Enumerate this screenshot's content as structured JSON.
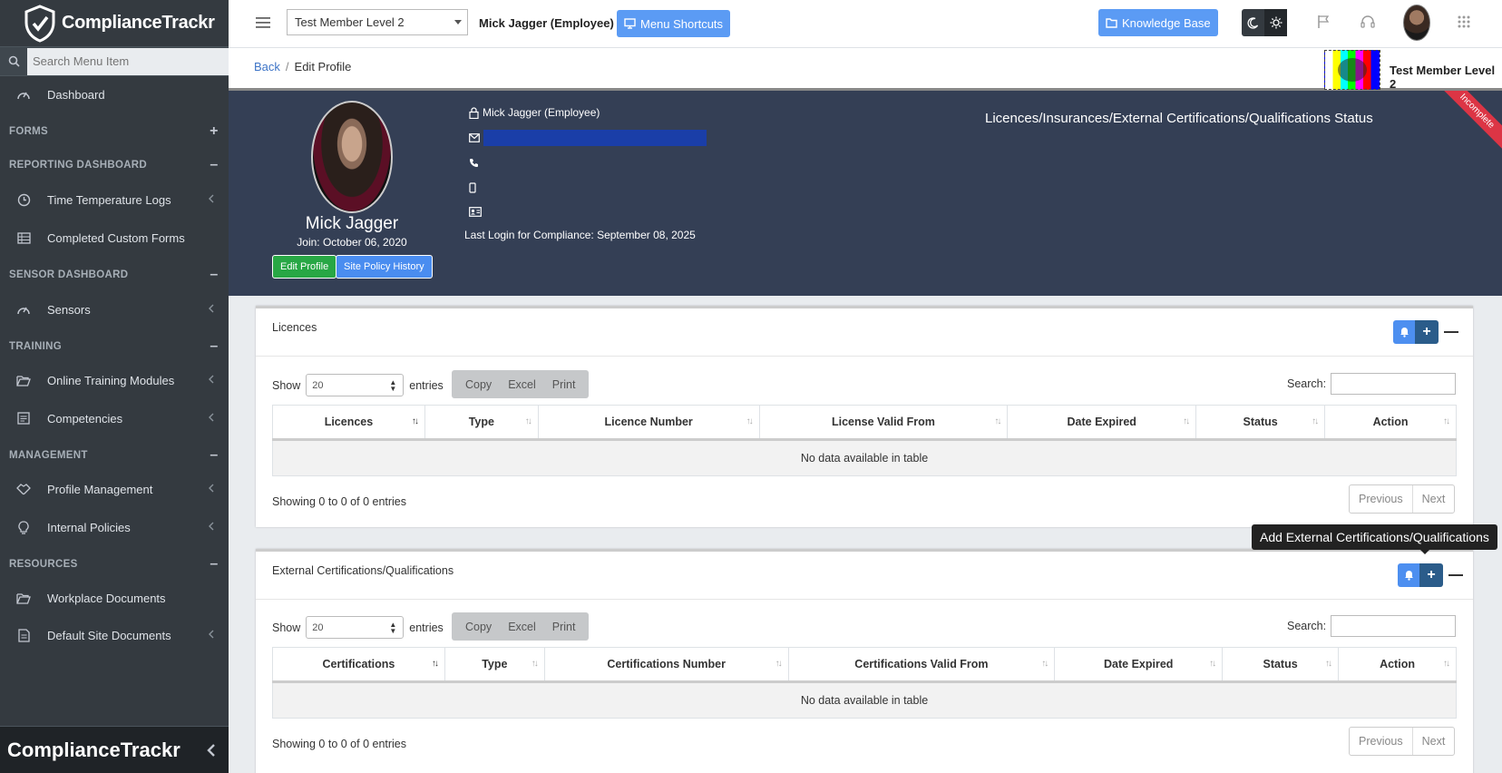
{
  "sidebar": {
    "brand": "ComplianceTrackr",
    "search_placeholder": "Search Menu Item",
    "items": [
      {
        "label": "Dashboard"
      },
      {
        "label": "Time Temperature Logs"
      },
      {
        "label": "Completed Custom Forms"
      },
      {
        "label": "Sensors"
      },
      {
        "label": "Online Training Modules"
      },
      {
        "label": "Competencies"
      },
      {
        "label": "Profile Management"
      },
      {
        "label": "Internal Policies"
      },
      {
        "label": "Workplace Documents"
      },
      {
        "label": "Default Site Documents"
      }
    ],
    "headers": [
      {
        "label": "FORMS",
        "toggle": "+"
      },
      {
        "label": "REPORTING DASHBOARD",
        "toggle": "–"
      },
      {
        "label": "SENSOR DASHBOARD",
        "toggle": "–"
      },
      {
        "label": "TRAINING",
        "toggle": "–"
      },
      {
        "label": "MANAGEMENT",
        "toggle": "–"
      },
      {
        "label": "RESOURCES",
        "toggle": "–"
      }
    ],
    "footer_brand": "ComplianceTrackr"
  },
  "topbar": {
    "member_select": "Test Member Level 2",
    "user_name": "Mick Jagger (Employee)",
    "menu_shortcuts": "Menu Shortcuts",
    "knowledge_base": "Knowledge Base"
  },
  "breadcrumb": {
    "back": "Back",
    "sep": "/",
    "current": "Edit Profile",
    "member_name": "Test Member Level 2"
  },
  "profile": {
    "name": "Mick Jagger",
    "join": "Join: October 06, 2020",
    "edit_btn": "Edit Profile",
    "policy_btn": "Site Policy History",
    "role": "Mick Jagger (Employee)",
    "last_login": "Last Login for Compliance: September 08, 2025",
    "status_title": "Licences/Insurances/External Certifications/Qualifications Status",
    "ribbon": "Incomplete"
  },
  "licences": {
    "title": "Licences",
    "show": "Show",
    "entries_value": "20",
    "entries": "entries",
    "exports": [
      "Copy",
      "Excel",
      "Print"
    ],
    "search_label": "Search:",
    "columns": [
      "Licences",
      "Type",
      "Licence Number",
      "License Valid From",
      "Date Expired",
      "Status",
      "Action"
    ],
    "empty": "No data available in table",
    "showing": "Showing 0 to 0 of 0 entries",
    "prev": "Previous",
    "next": "Next"
  },
  "certs": {
    "title": "External Certifications/Qualifications",
    "show": "Show",
    "entries_value": "20",
    "entries": "entries",
    "exports": [
      "Copy",
      "Excel",
      "Print"
    ],
    "search_label": "Search:",
    "columns": [
      "Certifications",
      "Type",
      "Certifications Number",
      "Certifications Valid From",
      "Date Expired",
      "Status",
      "Action"
    ],
    "empty": "No data available in table",
    "showing": "Showing 0 to 0 of 0 entries",
    "prev": "Previous",
    "next": "Next",
    "tooltip": "Add External Certifications/Qualifications"
  },
  "colors": {
    "sidebar": "#343a40",
    "profile_bg": "#343f55",
    "accent": "#5b9bf4",
    "success": "#28a745"
  }
}
